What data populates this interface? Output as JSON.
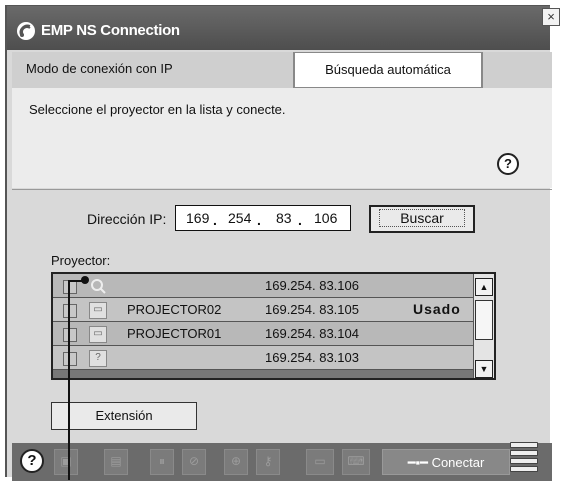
{
  "window": {
    "title": "EMP NS Connection",
    "close_symbol": "×"
  },
  "tabs": {
    "mode_label": "Modo de conexión con IP",
    "auto_label": "Búsqueda automática"
  },
  "info": {
    "message": "Seleccione el proyector en la lista y conecte.",
    "help_symbol": "?"
  },
  "ip": {
    "label": "Dirección IP:",
    "octets": [
      "169",
      "254",
      "83",
      "106"
    ],
    "search_label": "Buscar"
  },
  "projectors": {
    "label": "Proyector:",
    "rows": [
      {
        "name": "",
        "ip": "169.254. 83.106",
        "status": ""
      },
      {
        "name": "PROJECTOR02",
        "ip": "169.254. 83.105",
        "status": "Usado"
      },
      {
        "name": "PROJECTOR01",
        "ip": "169.254. 83.104",
        "status": ""
      },
      {
        "name": "",
        "ip": "169.254. 83.103",
        "status": ""
      }
    ]
  },
  "extension_label": "Extensión",
  "toolbar": {
    "help_symbol": "?",
    "connect_label": "Conectar",
    "icons": [
      "display-icon",
      "document-icon",
      "pause-icon",
      "no-display-icon",
      "zoom-icon",
      "key-icon",
      "monitor-icon",
      "keyboard-icon"
    ]
  },
  "colors": {
    "titlebar": "#5a5a5a",
    "window_bg": "#d9d9d9",
    "list_row": "#b8b8b8",
    "toolbar": "#6b6b6b"
  }
}
